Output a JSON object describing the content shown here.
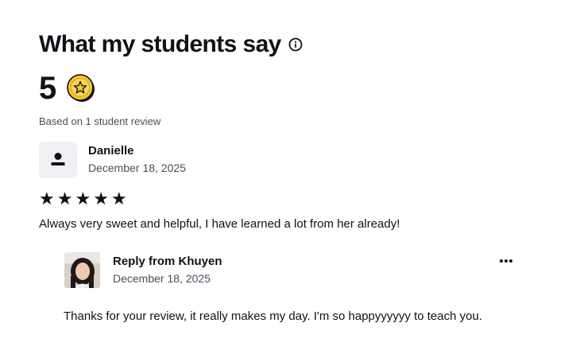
{
  "section": {
    "title": "What my students say",
    "info_icon": "info-circle-icon"
  },
  "rating": {
    "value": "5",
    "icon": "star-coin-icon",
    "based_on": "Based on 1 student review"
  },
  "review": {
    "avatar_icon": "anonymous-user-icon",
    "reviewer_name": "Danielle",
    "date": "December 18, 2025",
    "stars": 5,
    "star_glyph": "★",
    "text": "Always very sweet and helpful, I have learned a lot from her already!"
  },
  "reply": {
    "title": "Reply from Khuyen",
    "date": "December 18, 2025",
    "text": "Thanks for your review, it really makes my day. I'm so happyyyyyy to teach you.",
    "more_icon": "more-options-icon"
  },
  "colors": {
    "text_primary": "#121117",
    "text_secondary": "#4d4c5c",
    "coin_gold": "#f4c432",
    "avatar_bg": "#f0f0f4"
  }
}
